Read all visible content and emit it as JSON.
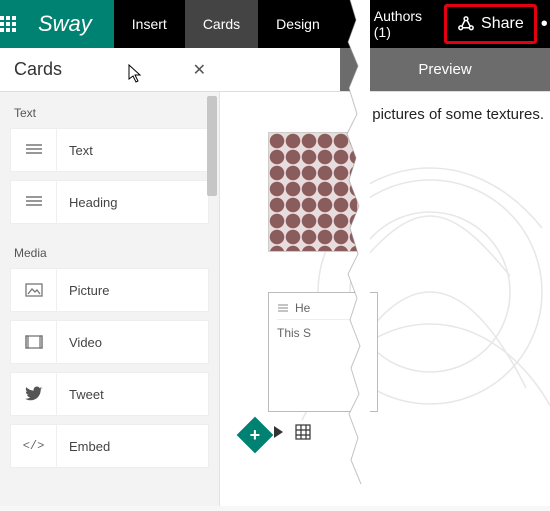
{
  "topbar": {
    "brand": "Sway",
    "tabs": [
      {
        "label": "Insert"
      },
      {
        "label": "Cards",
        "active": true
      },
      {
        "label": "Design"
      },
      {
        "label": "Authors (1)"
      }
    ],
    "share_label": "Share",
    "more": "•••"
  },
  "panel": {
    "title": "Cards",
    "close": "✕",
    "groups": [
      {
        "label": "Text",
        "items": [
          {
            "icon": "lines",
            "label": "Text"
          },
          {
            "icon": "lines",
            "label": "Heading"
          }
        ]
      },
      {
        "label": "Media",
        "items": [
          {
            "icon": "picture",
            "label": "Picture"
          },
          {
            "icon": "video",
            "label": "Video"
          },
          {
            "icon": "tweet",
            "label": "Tweet"
          },
          {
            "icon": "embed",
            "label": "Embed"
          }
        ]
      }
    ]
  },
  "preview": {
    "title": "Preview",
    "caption_fragment": "pictures of some textures.",
    "card_heading_fragment": "He",
    "card_body_fragment": "This S"
  }
}
